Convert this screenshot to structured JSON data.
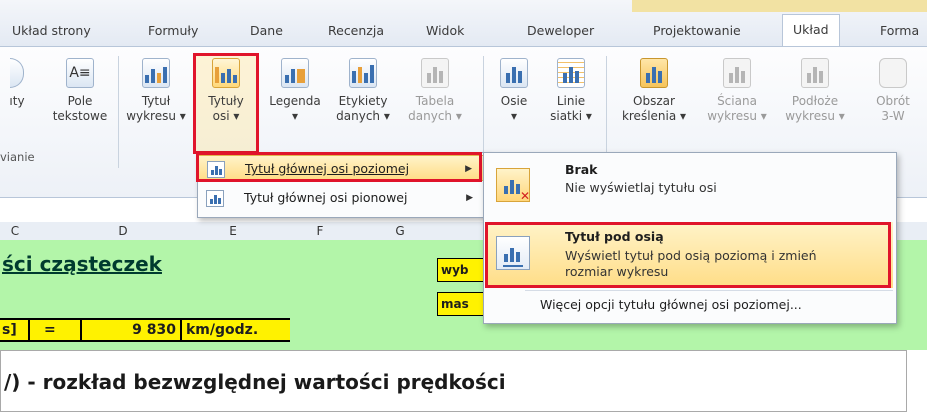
{
  "tabs": [
    "Układ strony",
    "Formuły",
    "Dane",
    "Recenzja",
    "Widok",
    "Deweloper",
    "Projektowanie",
    "Układ",
    "Forma"
  ],
  "ribbon": {
    "buttons": [
      {
        "l1": "ıty",
        "l2": ""
      },
      {
        "l1": "Pole",
        "l2": "tekstowe"
      },
      {
        "l1": "Tytuł",
        "l2": "wykresu ▾"
      },
      {
        "l1": "Tytuły",
        "l2": "osi ▾"
      },
      {
        "l1": "Legenda",
        "l2": "▾"
      },
      {
        "l1": "Etykiety",
        "l2": "danych ▾"
      },
      {
        "l1": "Tabela",
        "l2": "danych ▾"
      },
      {
        "l1": "Osie",
        "l2": "▾"
      },
      {
        "l1": "Linie",
        "l2": "siatki ▾"
      },
      {
        "l1": "Obszar",
        "l2": "kreślenia ▾"
      },
      {
        "l1": "Ściana",
        "l2": "wykresu ▾"
      },
      {
        "l1": "Podłoże",
        "l2": "wykresu ▾"
      },
      {
        "l1": "Obrót",
        "l2": "3-W"
      }
    ],
    "group_label": "vianie"
  },
  "columns": [
    "C",
    "D",
    "E",
    "F",
    "G"
  ],
  "sheet": {
    "title": "ści cząsteczek",
    "eq_left": "s]",
    "eq_sign": "=",
    "eq_value": "9 830",
    "eq_unit": "km/godz.",
    "cell_wyb": "wyb",
    "cell_mas": "mas",
    "chart_title": "/) - rozkład  bezwzględnej wartości prędkości"
  },
  "menu1": {
    "item1": "Tytuł głównej osi poziomej",
    "item2": "Tytuł głównej osi pionowej"
  },
  "menu2": {
    "opt1_title": "Brak",
    "opt1_desc": "Nie wyświetlaj tytułu osi",
    "opt2_title": "Tytuł pod osią",
    "opt2_desc1": "Wyświetl tytuł pod osią poziomą i zmień",
    "opt2_desc2": "rozmiar wykresu",
    "more": "Więcej opcji tytułu głównej osi poziomej..."
  }
}
